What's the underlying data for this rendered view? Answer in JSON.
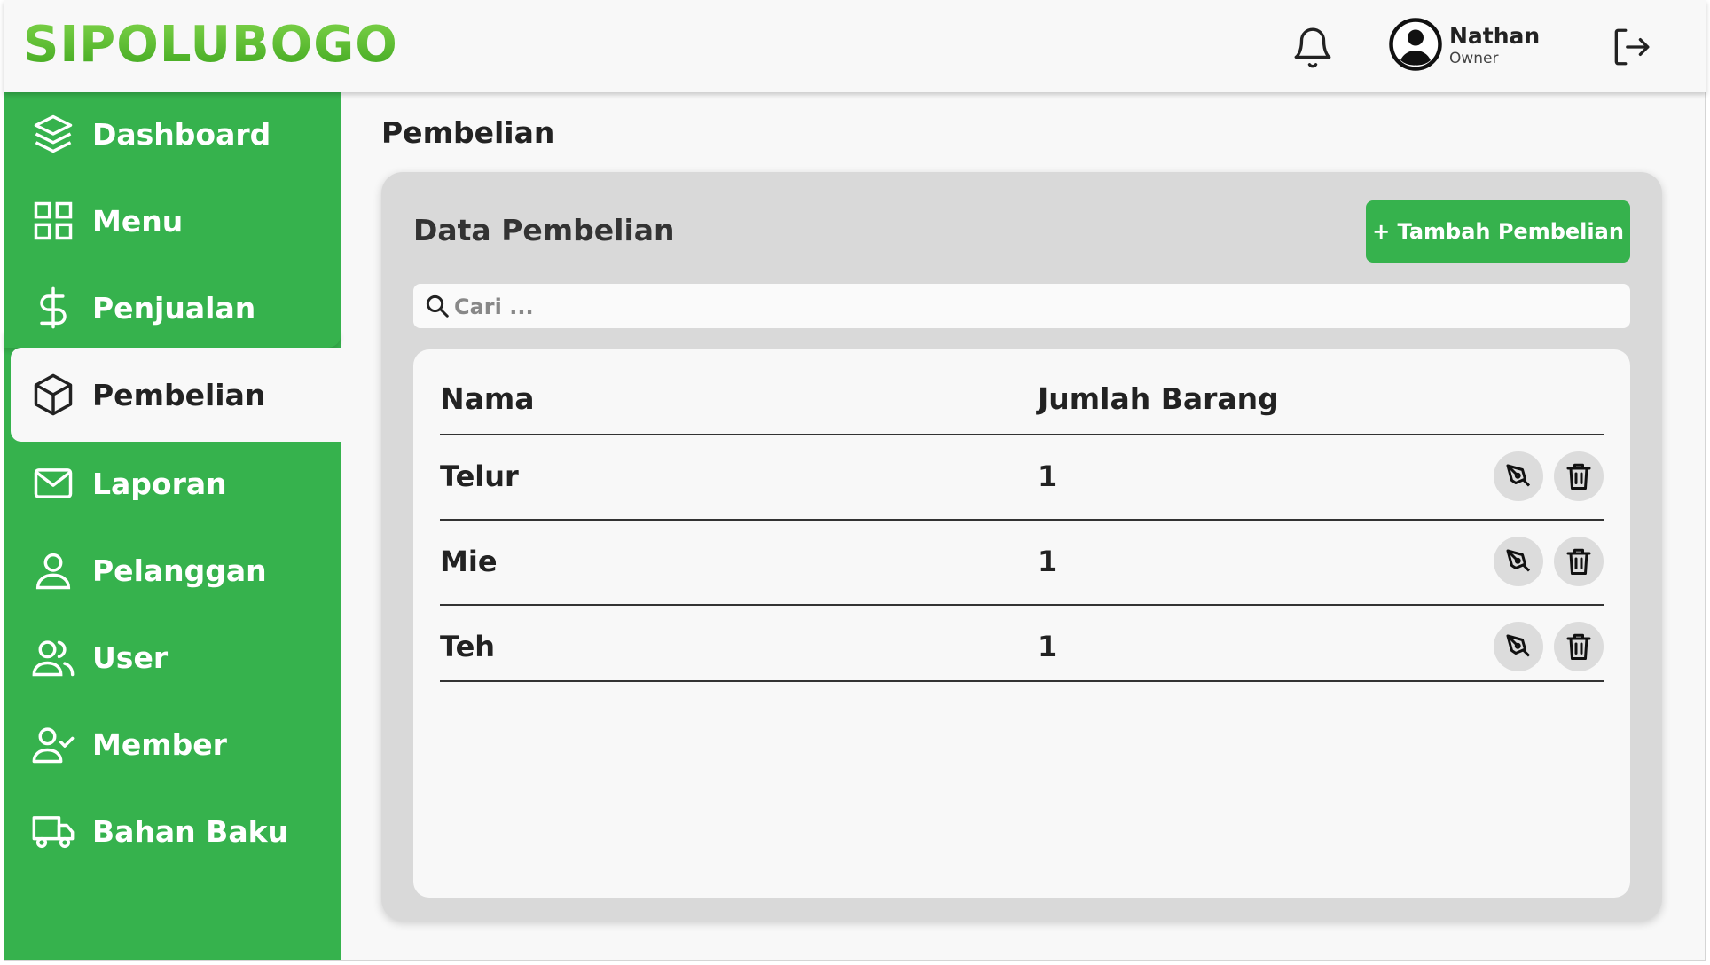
{
  "app": {
    "logo": "SIPOLUBOGO"
  },
  "header": {
    "user_name": "Nathan",
    "user_role": "Owner",
    "icons": [
      "bell-icon",
      "user-avatar-icon",
      "logout-icon"
    ]
  },
  "sidebar": {
    "items": [
      {
        "label": "Dashboard",
        "icon": "layers-icon"
      },
      {
        "label": "Menu",
        "icon": "grid-icon"
      },
      {
        "label": "Penjualan",
        "icon": "dollar-icon"
      },
      {
        "label": "Pembelian",
        "icon": "box-icon",
        "active": true
      },
      {
        "label": "Laporan",
        "icon": "mail-icon"
      },
      {
        "label": "Pelanggan",
        "icon": "user-icon"
      },
      {
        "label": "User",
        "icon": "users-icon"
      },
      {
        "label": "Member",
        "icon": "user-check-icon"
      },
      {
        "label": "Bahan Baku",
        "icon": "truck-icon"
      }
    ]
  },
  "main": {
    "page_title": "Pembelian",
    "card_title": "Data Pembelian",
    "add_button": "+ Tambah Pembelian",
    "search_placeholder": "Cari ...",
    "table": {
      "columns": [
        "Nama",
        "Jumlah Barang"
      ],
      "rows": [
        {
          "nama": "Telur",
          "jumlah": "1"
        },
        {
          "nama": "Mie",
          "jumlah": "1"
        },
        {
          "nama": "Teh",
          "jumlah": "1"
        }
      ]
    }
  },
  "colors": {
    "brand_green": "#36b24d",
    "logo_green": "#5cbd32",
    "card_bg": "#d9d9d9",
    "page_bg": "#f8f8f8"
  }
}
